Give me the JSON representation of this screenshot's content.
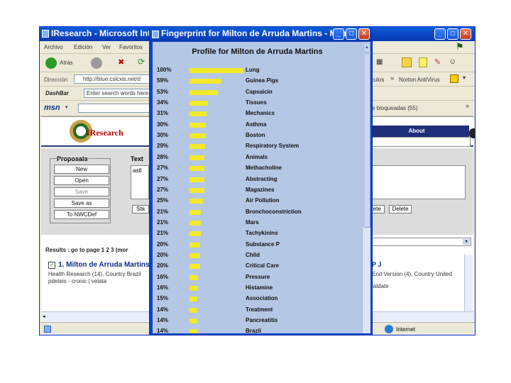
{
  "background_window": {
    "title": "IResearch - Microsoft Interne",
    "menu": [
      "Archivo",
      "Edición",
      "Ver",
      "Favoritos"
    ],
    "toolbar": {
      "back_label": "Atrás"
    },
    "address": {
      "label": "Dirección",
      "value": "http://blue.cslcxis.net/d"
    },
    "links": {
      "vinculos": "ínculos",
      "norton": "Norton AntiVirus"
    },
    "dashbar": {
      "label": "DashBar",
      "search_placeholder": "Enter search words here"
    },
    "msn": {
      "label": "msn",
      "bloqueadas": "e bloqueadas (55)"
    },
    "site": {
      "logo": "IResearch",
      "nav_about": "About",
      "proposals_label": "Proposals",
      "text_label": "Text",
      "text_value": "astl",
      "proposal_buttons": [
        "New",
        "Open",
        "Save",
        "Save as",
        "To NWCDef"
      ],
      "start_button": "Sta",
      "right_buttons": [
        "etete",
        "Delete"
      ],
      "results_label": "Results : go to page 1 2 3 (mor",
      "result_title": "1. Milton de Arruda Martins",
      "result_meta": "Health Research (14), Country Brazil",
      "result_meta2": "pdeteis - cronic | velata",
      "right_result_title": "P J",
      "right_result_meta": "End Version (4), Country United",
      "right_result_meta2": "ialdate"
    },
    "status": {
      "zone": "Internet"
    }
  },
  "popup": {
    "title": "Fingerprint for Milton de Arruda Martins - Micr...",
    "heading": "Profile for Milton de Arruda Martins",
    "colors": {
      "bar": "#f2ea2a",
      "panel": "#b4c7e4"
    },
    "rows": [
      {
        "pct": "100%",
        "value": 100,
        "term": "Lung"
      },
      {
        "pct": "59%",
        "value": 59,
        "term": "Guinea Pigs"
      },
      {
        "pct": "53%",
        "value": 53,
        "term": "Capsaicin"
      },
      {
        "pct": "34%",
        "value": 34,
        "term": "Tissues"
      },
      {
        "pct": "31%",
        "value": 31,
        "term": "Mechanics"
      },
      {
        "pct": "30%",
        "value": 30,
        "term": "Asthma"
      },
      {
        "pct": "30%",
        "value": 30,
        "term": "Boston"
      },
      {
        "pct": "29%",
        "value": 29,
        "term": "Respiratory System"
      },
      {
        "pct": "28%",
        "value": 28,
        "term": "Animals"
      },
      {
        "pct": "27%",
        "value": 27,
        "term": "Methacholine"
      },
      {
        "pct": "27%",
        "value": 27,
        "term": "Abstracting"
      },
      {
        "pct": "27%",
        "value": 27,
        "term": "Magazines"
      },
      {
        "pct": "25%",
        "value": 25,
        "term": "Air Pollution"
      },
      {
        "pct": "21%",
        "value": 21,
        "term": "Bronchoconstriction"
      },
      {
        "pct": "21%",
        "value": 21,
        "term": "Mars"
      },
      {
        "pct": "21%",
        "value": 21,
        "term": "Tachykinins"
      },
      {
        "pct": "20%",
        "value": 20,
        "term": "Substance P"
      },
      {
        "pct": "20%",
        "value": 20,
        "term": "Child"
      },
      {
        "pct": "20%",
        "value": 20,
        "term": "Critical Care"
      },
      {
        "pct": "16%",
        "value": 16,
        "term": "Pressure"
      },
      {
        "pct": "16%",
        "value": 16,
        "term": "Histamine"
      },
      {
        "pct": "15%",
        "value": 15,
        "term": "Association"
      },
      {
        "pct": "14%",
        "value": 14,
        "term": "Treatment"
      },
      {
        "pct": "14%",
        "value": 14,
        "term": "Pancreatitis"
      },
      {
        "pct": "14%",
        "value": 14,
        "term": "Brazil"
      }
    ]
  }
}
